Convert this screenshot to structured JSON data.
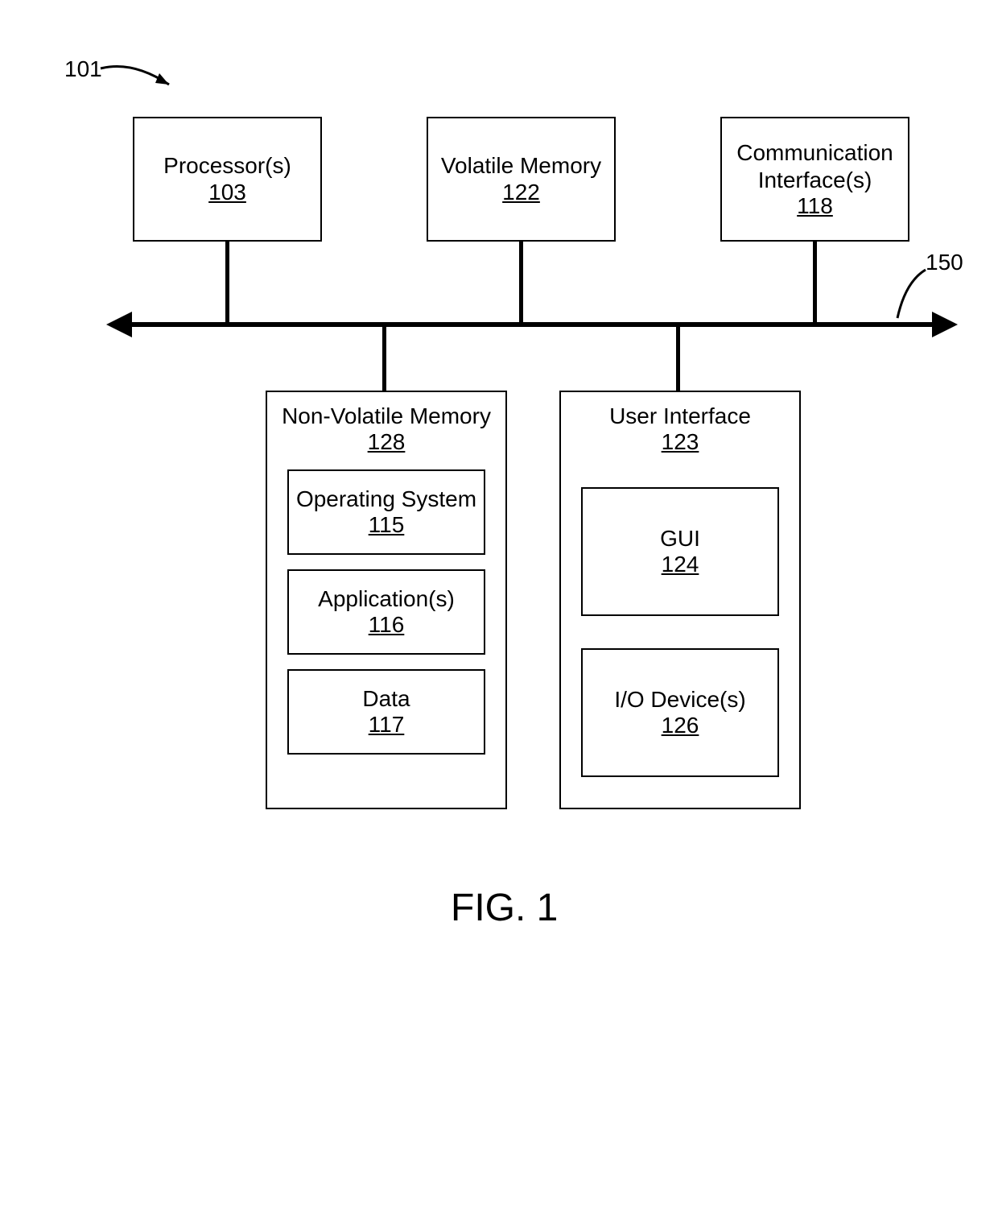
{
  "figure_label": "FIG. 1",
  "system_ref": "101",
  "bus_ref": "150",
  "top_boxes": {
    "processor": {
      "label": "Processor(s)",
      "ref": "103"
    },
    "volatile": {
      "label": "Volatile Memory",
      "ref": "122"
    },
    "comm": {
      "label": "Communication Interface(s)",
      "ref": "118"
    }
  },
  "nonvolatile_block": {
    "title": {
      "label": "Non-Volatile Memory",
      "ref": "128"
    },
    "os": {
      "label": "Operating System",
      "ref": "115"
    },
    "app": {
      "label": "Application(s)",
      "ref": "116"
    },
    "data": {
      "label": "Data",
      "ref": "117"
    }
  },
  "ui_block": {
    "title": {
      "label": "User Interface",
      "ref": "123"
    },
    "gui": {
      "label": "GUI",
      "ref": "124"
    },
    "io": {
      "label": "I/O Device(s)",
      "ref": "126"
    }
  }
}
